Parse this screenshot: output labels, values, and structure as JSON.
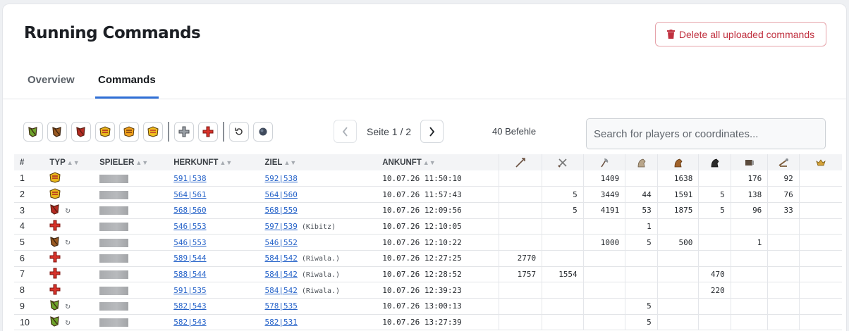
{
  "header": {
    "title": "Running Commands",
    "delete_label": "Delete all uploaded commands"
  },
  "tabs": [
    {
      "label": "Overview"
    },
    {
      "label": "Commands"
    }
  ],
  "pager": {
    "text": "Seite 1 / 2",
    "count": "40 Befehle"
  },
  "search": {
    "placeholder": "Search for players or coordinates..."
  },
  "toolbar": {
    "filters": [
      "axe-green-icon",
      "axe-brown-icon",
      "axe-red-icon",
      "noble-yellow-icon",
      "noble-orange-icon",
      "noble-mixed-icon",
      "support-grey-icon",
      "support-red-icon",
      "return-icon",
      "circle-icon"
    ]
  },
  "table": {
    "headers": {
      "idx": "#",
      "typ": "TYP",
      "spieler": "SPIELER",
      "herkunft": "HERKUNFT",
      "ziel": "ZIEL",
      "ankunft": "ANKUNFT"
    },
    "unit_icons": [
      "spear-icon",
      "sword-icon",
      "axe-icon",
      "scout-icon",
      "light-cavalry-icon",
      "heavy-cavalry-icon",
      "ram-icon",
      "catapult-icon",
      "noble-icon"
    ],
    "rows": [
      {
        "idx": "1",
        "typ": "noble-yellow",
        "ret": false,
        "herkunft": "591|538",
        "ziel": "592|538",
        "note": "",
        "ankunft": "10.07.26 11:50:10",
        "units": [
          "",
          "",
          "1409",
          "",
          "1638",
          "",
          "176",
          "92",
          ""
        ]
      },
      {
        "idx": "2",
        "typ": "noble-yellow",
        "ret": false,
        "herkunft": "564|561",
        "ziel": "564|560",
        "note": "",
        "ankunft": "10.07.26 11:57:43",
        "units": [
          "",
          "5",
          "3449",
          "44",
          "1591",
          "5",
          "138",
          "76",
          ""
        ]
      },
      {
        "idx": "3",
        "typ": "axe-red",
        "ret": true,
        "herkunft": "568|560",
        "ziel": "568|559",
        "note": "",
        "ankunft": "10.07.26 12:09:56",
        "units": [
          "",
          "5",
          "4191",
          "53",
          "1875",
          "5",
          "96",
          "33",
          ""
        ]
      },
      {
        "idx": "4",
        "typ": "support-red",
        "ret": false,
        "herkunft": "546|553",
        "ziel": "597|539",
        "note": "(Kibitz)",
        "ankunft": "10.07.26 12:10:05",
        "units": [
          "",
          "",
          "",
          "1",
          "",
          "",
          "",
          "",
          ""
        ]
      },
      {
        "idx": "5",
        "typ": "axe-brown",
        "ret": true,
        "herkunft": "546|553",
        "ziel": "546|552",
        "note": "",
        "ankunft": "10.07.26 12:10:22",
        "units": [
          "",
          "",
          "1000",
          "5",
          "500",
          "",
          "1",
          "",
          ""
        ]
      },
      {
        "idx": "6",
        "typ": "support-red",
        "ret": false,
        "herkunft": "589|544",
        "ziel": "584|542",
        "note": "(Riwala.)",
        "ankunft": "10.07.26 12:27:25",
        "units": [
          "2770",
          "",
          "",
          "",
          "",
          "",
          "",
          "",
          ""
        ]
      },
      {
        "idx": "7",
        "typ": "support-red",
        "ret": false,
        "herkunft": "588|544",
        "ziel": "584|542",
        "note": "(Riwala.)",
        "ankunft": "10.07.26 12:28:52",
        "units": [
          "1757",
          "1554",
          "",
          "",
          "",
          "470",
          "",
          "",
          ""
        ]
      },
      {
        "idx": "8",
        "typ": "support-red",
        "ret": false,
        "herkunft": "591|535",
        "ziel": "584|542",
        "note": "(Riwala.)",
        "ankunft": "10.07.26 12:39:23",
        "units": [
          "",
          "",
          "",
          "",
          "",
          "220",
          "",
          "",
          ""
        ]
      },
      {
        "idx": "9",
        "typ": "axe-green",
        "ret": true,
        "herkunft": "582|543",
        "ziel": "578|535",
        "note": "",
        "ankunft": "10.07.26 13:00:13",
        "units": [
          "",
          "",
          "",
          "5",
          "",
          "",
          "",
          "",
          ""
        ]
      },
      {
        "idx": "10",
        "typ": "axe-green",
        "ret": true,
        "herkunft": "582|543",
        "ziel": "582|531",
        "note": "",
        "ankunft": "10.07.26 13:27:39",
        "units": [
          "",
          "",
          "",
          "5",
          "",
          "",
          "",
          "",
          ""
        ]
      }
    ]
  },
  "colors": {
    "accent": "#2f6fd6",
    "link": "#2663c9",
    "danger": "#c0303f"
  }
}
